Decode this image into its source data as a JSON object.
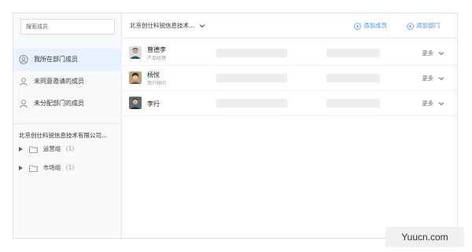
{
  "sidebar": {
    "search_placeholder": "搜索成员",
    "items": [
      {
        "label": "我所在部门成员",
        "icon": "user-icon",
        "active": true
      },
      {
        "label": "未同意邀请的成员",
        "icon": "user-pending-icon",
        "active": false
      },
      {
        "label": "未分配部门的成员",
        "icon": "user-unassigned-icon",
        "active": false
      }
    ],
    "company": "北京创仕科锐信息技术有限公司...",
    "groups": [
      {
        "label": "运营组",
        "count": "(1)"
      },
      {
        "label": "市场组",
        "count": "(1)"
      }
    ]
  },
  "header": {
    "org_name": "北京创仕科锐信息技术...",
    "add_member": "添加成员",
    "add_department": "添加部门"
  },
  "members": [
    {
      "name": "曾德李",
      "role": "产品经理",
      "more": "更多"
    },
    {
      "name": "杨悦",
      "role": "用户顾问",
      "more": "更多"
    },
    {
      "name": "李行",
      "role": "",
      "more": "更多"
    }
  ],
  "watermark": "Yuucn.com",
  "colors": {
    "accent": "#4a8fe2",
    "active_bg": "#e8f1ff",
    "placeholder": "#eeeeee"
  }
}
